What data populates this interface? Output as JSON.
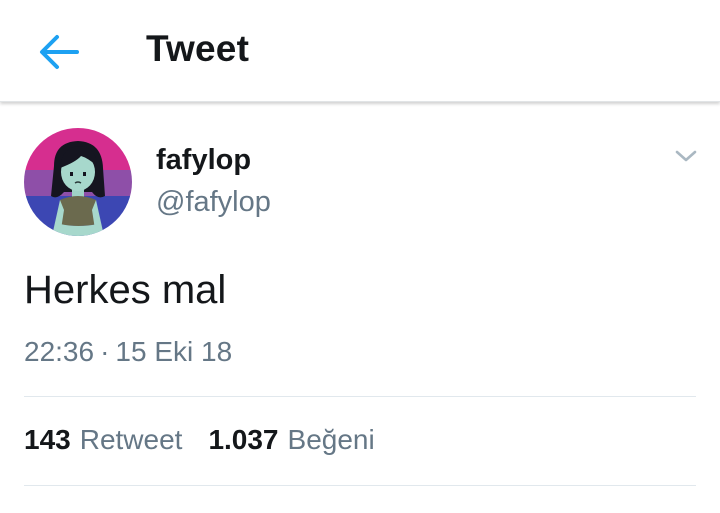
{
  "header": {
    "title": "Tweet",
    "back_icon": "arrow-left-icon",
    "accent_color": "#1da1f2"
  },
  "tweet": {
    "display_name": "fafylop",
    "handle": "@fafylop",
    "text": "Herkes mal",
    "time": "22:36",
    "separator": "·",
    "date": "15 Eki 18",
    "menu_icon": "chevron-down-icon",
    "avatar_icon": "avatar-cartoon-girl"
  },
  "stats": {
    "retweets_count": "143",
    "retweets_label": "Retweet",
    "likes_count": "1.037",
    "likes_label": "Beğeni"
  }
}
